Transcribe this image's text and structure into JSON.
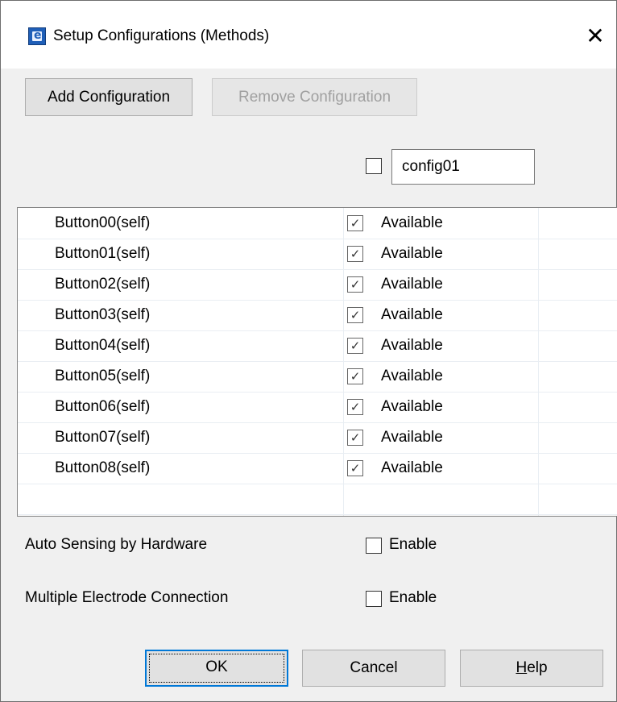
{
  "window": {
    "title": "Setup Configurations (Methods)",
    "close_glyph": "✕",
    "icon": "app-icon"
  },
  "toolbar": {
    "add_label": "Add Configuration",
    "remove_label": "Remove Configuration"
  },
  "config": {
    "name": "config01",
    "checked": false
  },
  "table": {
    "rows": [
      {
        "name": "Button00(self)",
        "status": "Available",
        "checked": true
      },
      {
        "name": "Button01(self)",
        "status": "Available",
        "checked": true
      },
      {
        "name": "Button02(self)",
        "status": "Available",
        "checked": true
      },
      {
        "name": "Button03(self)",
        "status": "Available",
        "checked": true
      },
      {
        "name": "Button04(self)",
        "status": "Available",
        "checked": true
      },
      {
        "name": "Button05(self)",
        "status": "Available",
        "checked": true
      },
      {
        "name": "Button06(self)",
        "status": "Available",
        "checked": true
      },
      {
        "name": "Button07(self)",
        "status": "Available",
        "checked": true
      },
      {
        "name": "Button08(self)",
        "status": "Available",
        "checked": true
      }
    ],
    "check_glyph": "✓"
  },
  "options": {
    "auto_sensing": {
      "label": "Auto Sensing by Hardware",
      "enable_label": "Enable",
      "checked": false
    },
    "multi_electrode": {
      "label": "Multiple Electrode Connection",
      "enable_label": "Enable",
      "checked": false
    }
  },
  "footer": {
    "ok_label": "OK",
    "cancel_label": "Cancel",
    "help_label": "Help",
    "help_mnemonic": "H",
    "help_rest": "elp"
  },
  "colors": {
    "button_face": "#e1e1e1",
    "disabled_text": "#a0a0a0",
    "focus_border": "#0078d7"
  }
}
